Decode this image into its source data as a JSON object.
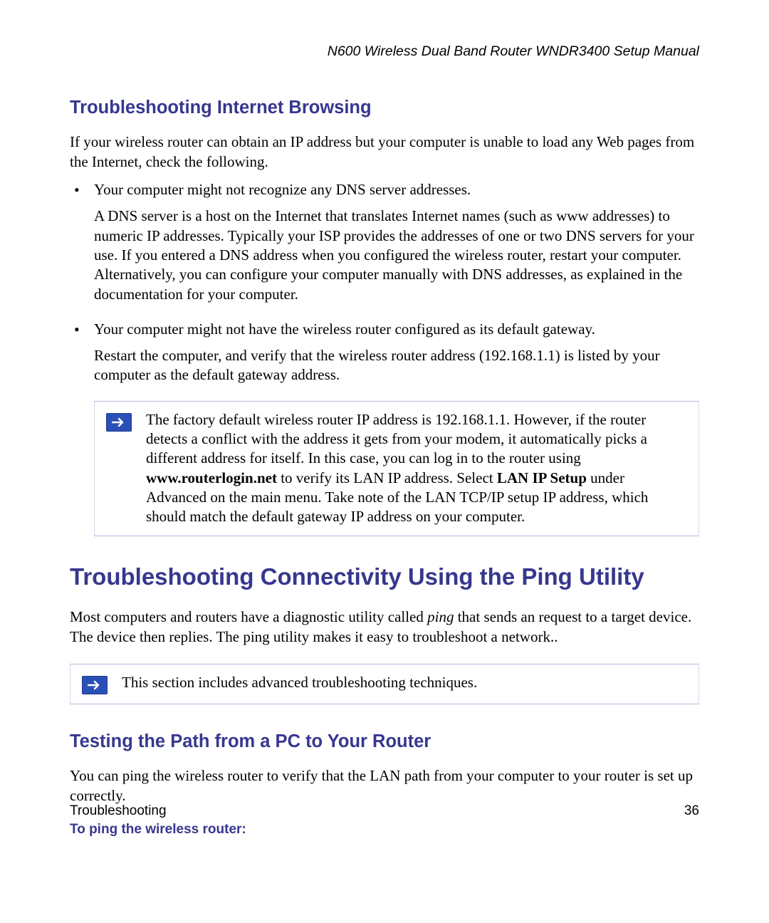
{
  "header": {
    "title": "N600 Wireless Dual Band Router WNDR3400 Setup Manual"
  },
  "section1": {
    "heading": "Troubleshooting Internet Browsing",
    "intro": "If your wireless router can obtain an IP address but your computer is unable to load any Web pages from the Internet, check the following.",
    "bullets": [
      {
        "lead": "Your computer might not recognize any DNS server addresses.",
        "detail": "A DNS server is a host on the Internet that translates Internet names (such as www addresses) to numeric IP addresses. Typically your ISP provides the addresses of one or two DNS servers for your use. If you entered a DNS address when you configured the wireless router, restart your computer. Alternatively, you can configure your computer manually with DNS addresses, as explained in the documentation for your computer."
      },
      {
        "lead": "Your computer might not have the wireless router configured as its default gateway.",
        "detail": "Restart the computer, and verify that the wireless router address (192.168.1.1) is listed by your computer as the default gateway address."
      }
    ],
    "note": {
      "pre": "The factory default wireless router IP address is 192.168.1.1. However, if the router detects a conflict with the address it gets from your modem, it automatically picks a different address for itself. In this case, you can log in to the router using ",
      "bold1": "www.routerlogin.net",
      "mid1": " to verify its LAN IP address. Select ",
      "bold2": "LAN IP Setup",
      "post": " under Advanced on the main menu. Take note of the LAN TCP/IP setup IP address, which should match the default gateway IP address on your computer."
    }
  },
  "section2": {
    "heading": "Troubleshooting Connectivity Using the Ping Utility",
    "intro_pre": "Most computers and routers have a diagnostic utility called ",
    "intro_em": "ping",
    "intro_post": " that sends an request to a target device. The device then replies. The ping utility makes it easy to troubleshoot a network..",
    "note": "This section includes advanced troubleshooting techniques.",
    "sub_heading": "Testing the Path from a PC to Your Router",
    "sub_intro": "You can ping the wireless router to verify that the LAN path from your computer to your router is set up correctly.",
    "action": "To ping the wireless router:"
  },
  "footer": {
    "section": "Troubleshooting",
    "page": "36"
  }
}
